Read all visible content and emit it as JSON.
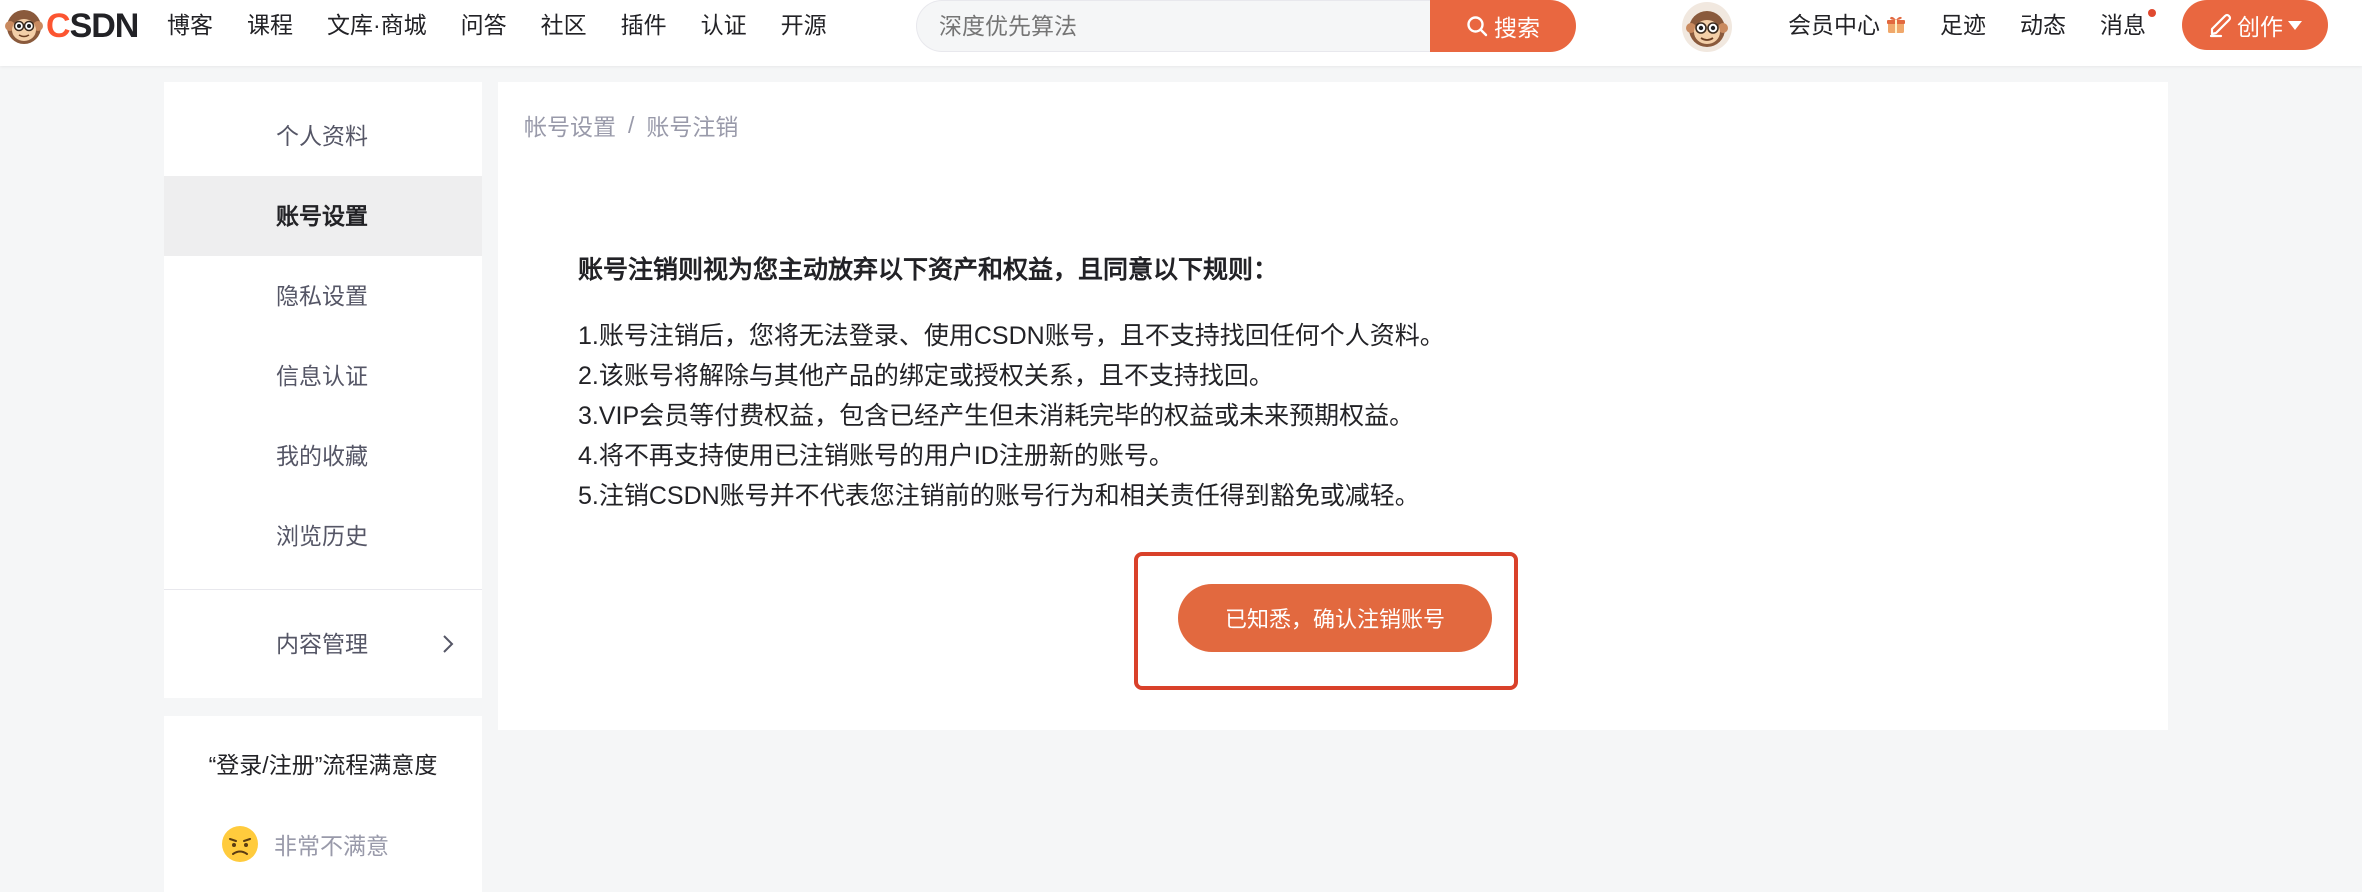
{
  "header": {
    "logo_text_a": "C",
    "logo_text_b": "SDN",
    "nav": [
      "博客",
      "课程",
      "文库·商城",
      "问答",
      "社区",
      "插件",
      "认证",
      "开源"
    ],
    "search_placeholder": "深度优先算法",
    "search_button": "搜索",
    "links": {
      "vip": "会员中心",
      "footprint": "足迹",
      "activity": "动态",
      "messages": "消息"
    },
    "create_button": "创作",
    "accent": "#e96740"
  },
  "sidebar": {
    "items": [
      {
        "label": "个人资料",
        "active": false
      },
      {
        "label": "账号设置",
        "active": true
      },
      {
        "label": "隐私设置",
        "active": false
      },
      {
        "label": "信息认证",
        "active": false
      },
      {
        "label": "我的收藏",
        "active": false
      },
      {
        "label": "浏览历史",
        "active": false
      }
    ],
    "content_management": "内容管理"
  },
  "survey": {
    "title": "“登录/注册”流程满意度",
    "option": "非常不满意"
  },
  "main": {
    "breadcrumb": [
      "帐号设置",
      "账号注销"
    ],
    "notice_title": "账号注销则视为您主动放弃以下资产和权益，且同意以下规则：",
    "rules": [
      "1.账号注销后，您将无法登录、使用CSDN账号，且不支持找回任何个人资料。",
      "2.该账号将解除与其他产品的绑定或授权关系，且不支持找回。",
      "3.VIP会员等付费权益，包含已经产生但未消耗完毕的权益或未来预期权益。",
      "4.将不再支持使用已注销账号的用户ID注册新的账号。",
      "5.注销CSDN账号并不代表您注销前的账号行为和相关责任得到豁免或减轻。"
    ],
    "confirm_button": "已知悉，确认注销账号",
    "highlight_color": "#d9412a"
  }
}
